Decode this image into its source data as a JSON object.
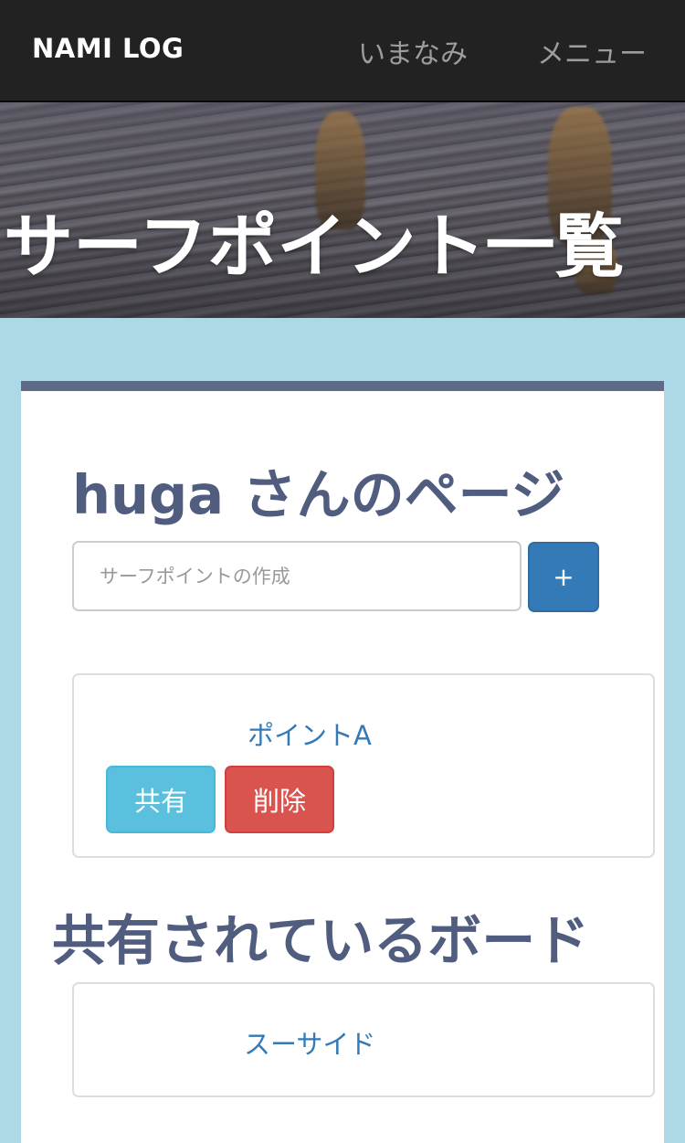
{
  "navbar": {
    "brand": "NAMI LOG",
    "links": [
      {
        "label": "いまなみ"
      },
      {
        "label": "メニュー"
      }
    ]
  },
  "hero": {
    "title": "サーフポイント一覧"
  },
  "main": {
    "heading": "huga さんのページ",
    "create": {
      "placeholder": "サーフポイントの作成",
      "button_label": "+"
    },
    "points": [
      {
        "name": "ポイントA",
        "share_label": "共有",
        "delete_label": "削除"
      }
    ],
    "shared_heading": "共有されているボード",
    "shared_boards": [
      {
        "name": "スーサイド"
      }
    ]
  },
  "colors": {
    "background": "#add8e6",
    "navbar": "#222222",
    "heading": "#505d7f",
    "link": "#337ab7",
    "primary_button": "#337ab7",
    "share_button": "#5bc0de",
    "delete_button": "#d9534f"
  }
}
